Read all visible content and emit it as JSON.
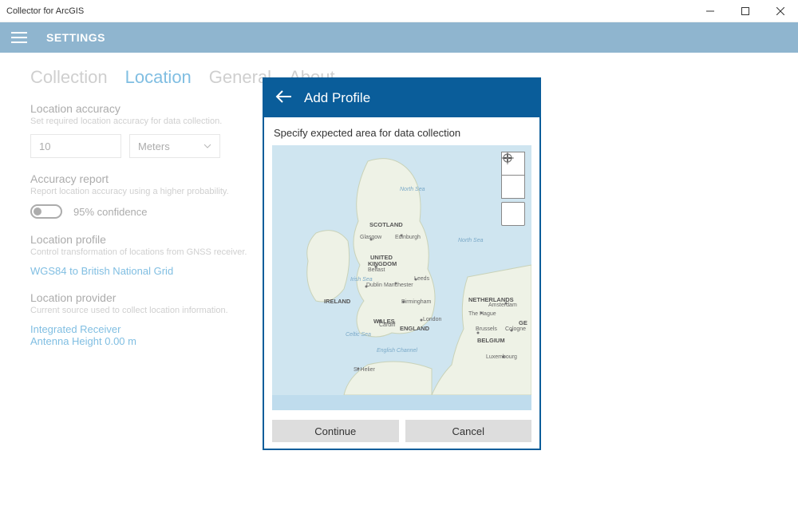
{
  "window": {
    "title": "Collector for ArcGIS"
  },
  "header": {
    "title": "SETTINGS"
  },
  "tabs": {
    "collection": "Collection",
    "location": "Location",
    "general": "General",
    "about": "About"
  },
  "settings": {
    "accuracy": {
      "title": "Location accuracy",
      "desc": "Set required location accuracy for data collection.",
      "value": "10",
      "unit": "Meters"
    },
    "report": {
      "title": "Accuracy report",
      "desc": "Report location accuracy using a higher probability.",
      "toggle_label": "95% confidence"
    },
    "profile": {
      "title": "Location profile",
      "desc": "Control transformation of locations from GNSS receiver.",
      "link": "WGS84 to British National Grid"
    },
    "provider": {
      "title": "Location provider",
      "desc": "Current source used to collect location information.",
      "link1": "Integrated Receiver",
      "link2": "Antenna Height 0.00 m"
    }
  },
  "dialog": {
    "title": "Add Profile",
    "instruction": "Specify expected area for data collection",
    "continue": "Continue",
    "cancel": "Cancel"
  },
  "map": {
    "seas": {
      "north_sea": "North Sea",
      "north_sea2": "North Sea",
      "irish_sea": "Irish Sea",
      "celtic_sea": "Celtic Sea",
      "english_channel": "English Channel"
    },
    "countries": {
      "scotland": "SCOTLAND",
      "uk1": "UNITED",
      "uk2": "KINGDOM",
      "ireland": "IRELAND",
      "wales": "WALES",
      "england": "ENGLAND",
      "netherlands": "NETHERLANDS",
      "belgium": "BELGIUM",
      "ge": "GE"
    },
    "cities": {
      "glasgow": "Glasgow",
      "edinburgh": "Edinburgh",
      "belfast": "Belfast",
      "dublin": "Dublin",
      "manchester": "Manchester",
      "leeds": "Leeds",
      "birmingham": "Birmingham",
      "cardiff": "Cardiff",
      "london": "London",
      "amsterdam": "Amsterdam",
      "thehague": "The Hague",
      "brussels": "Brussels",
      "cologne": "Cologne",
      "luxembourg": "Luxembourg",
      "sthelier": "St Helier"
    }
  }
}
